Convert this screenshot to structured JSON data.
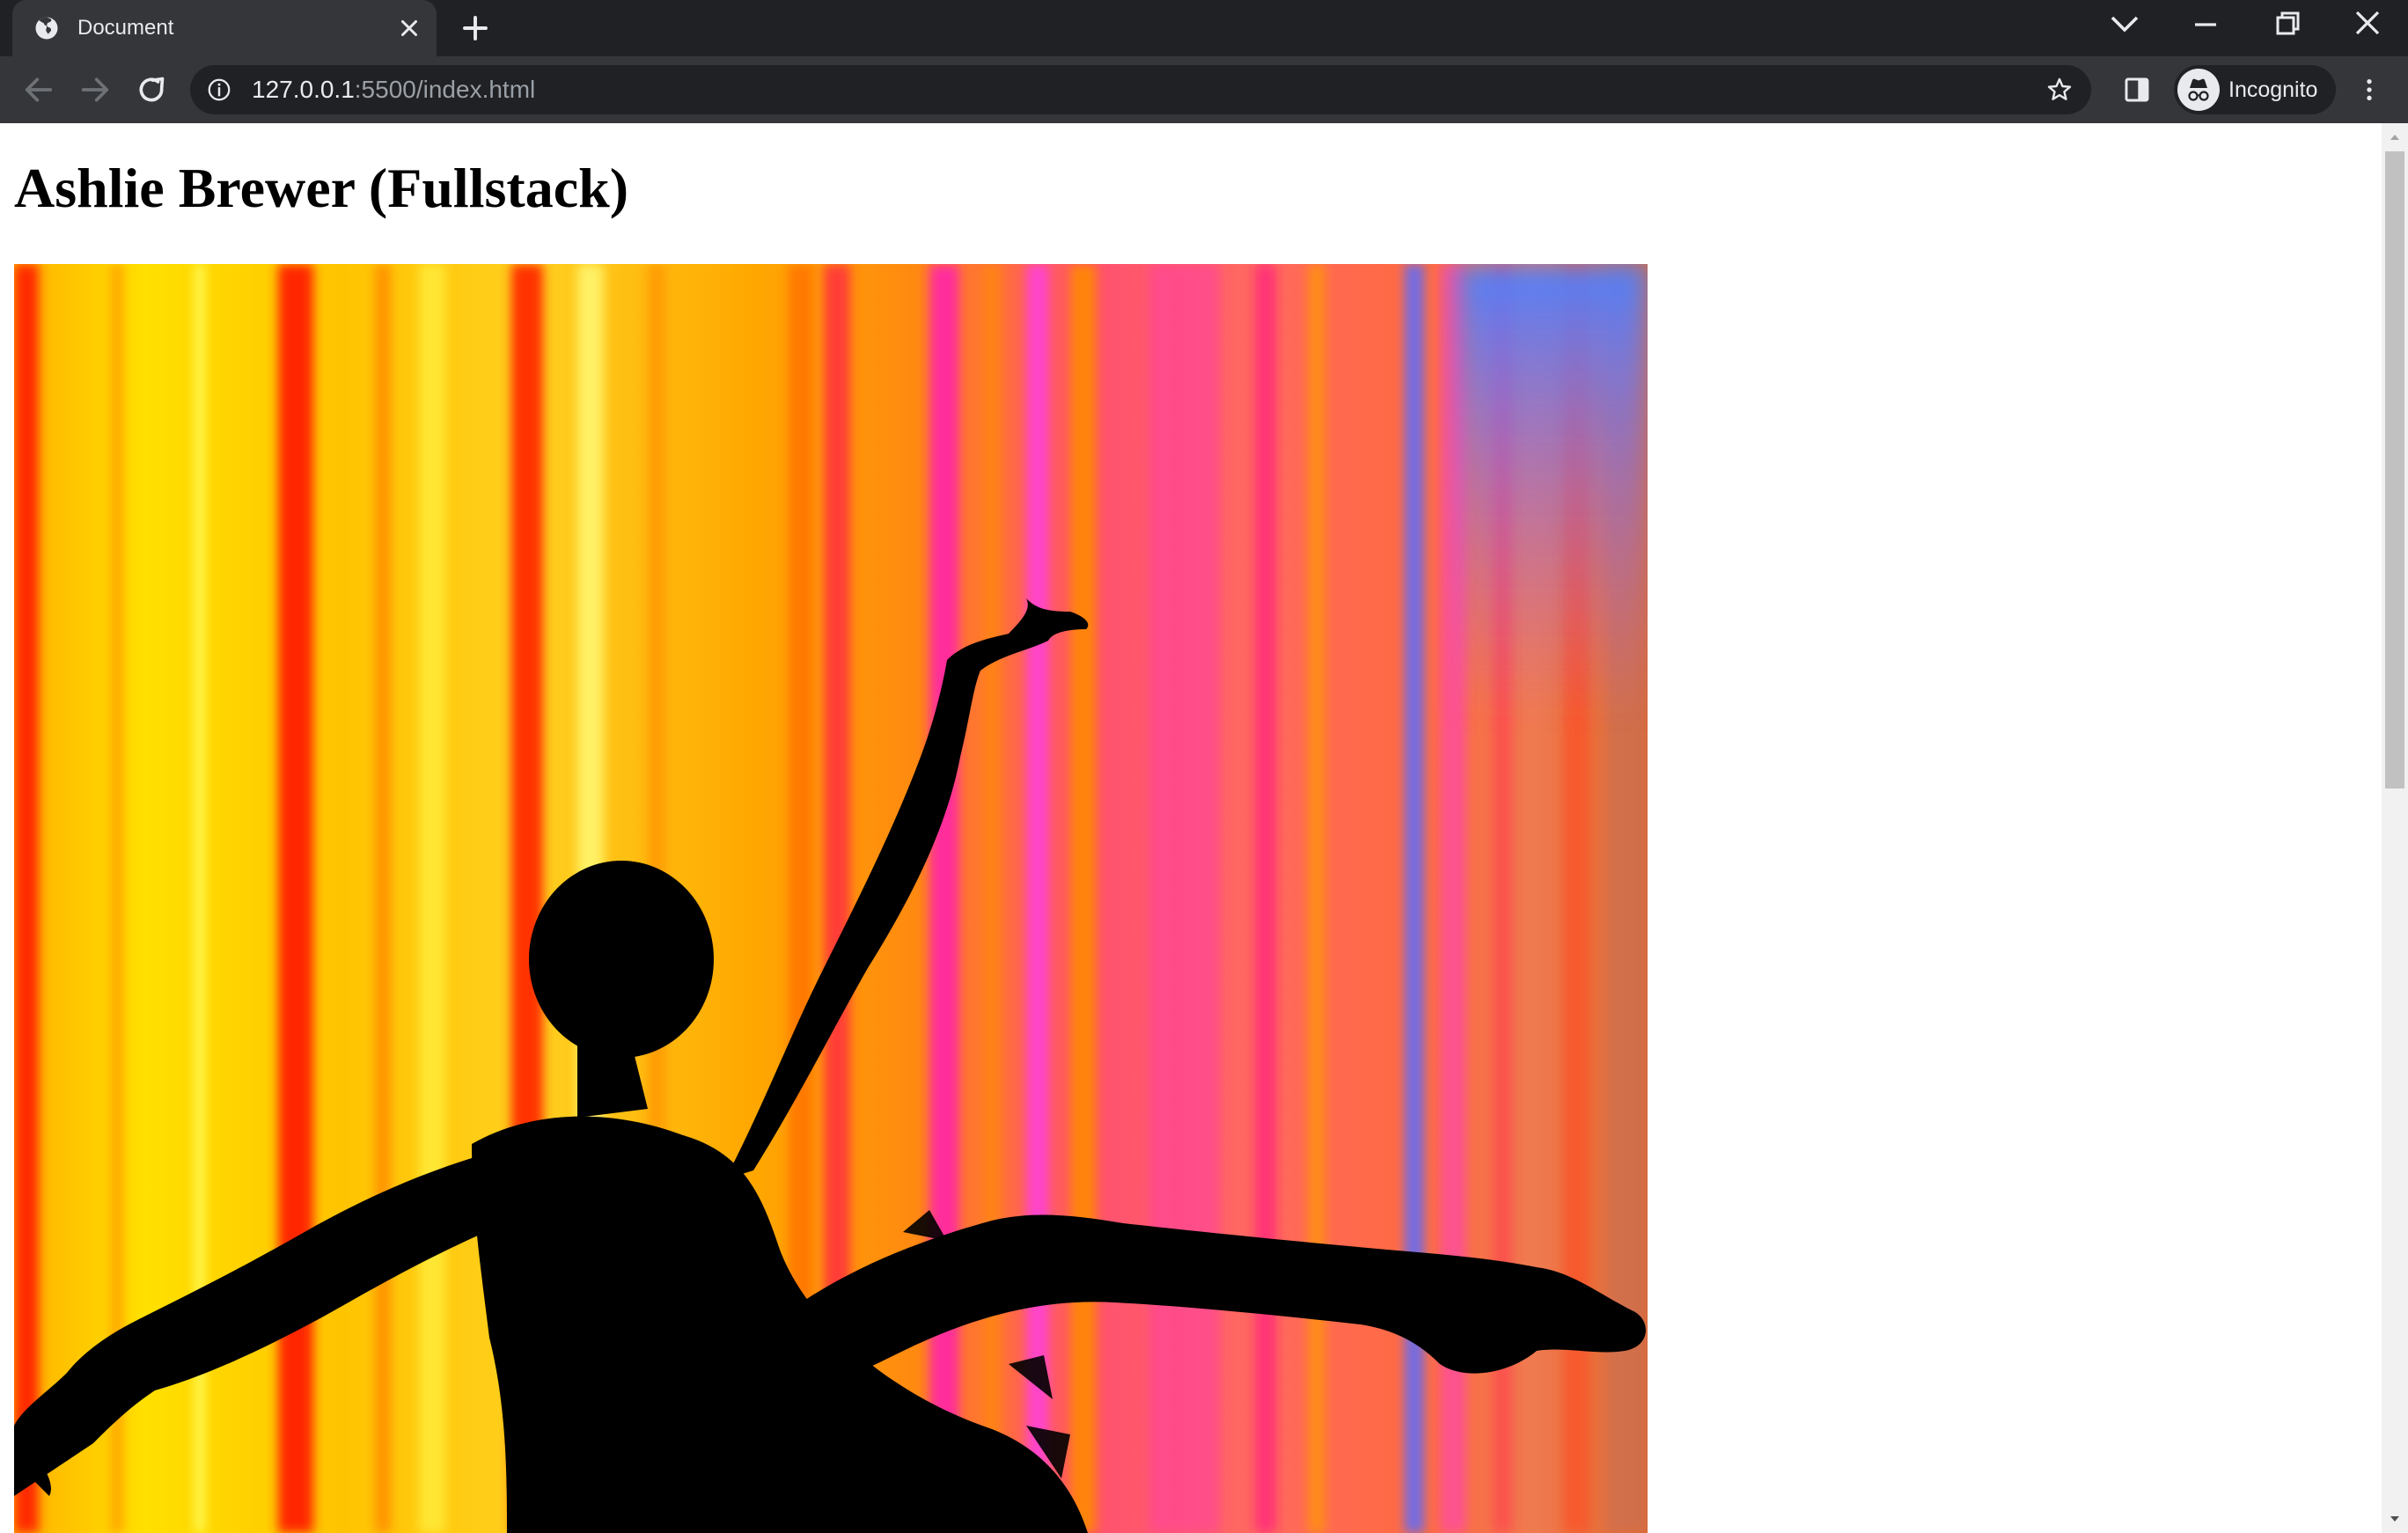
{
  "browser": {
    "tab": {
      "title": "Document"
    },
    "address_bar": {
      "host": "127.0.0.1",
      "port_and_path": ":5500/index.html"
    },
    "profile": {
      "label": "Incognito"
    }
  },
  "page": {
    "heading": "Ashlie Brewer (Fullstack)"
  },
  "icons": [
    "globe-icon",
    "close-icon",
    "plus-icon",
    "chevron-down-icon",
    "minimize-icon",
    "restore-icon",
    "window-close-icon",
    "back-icon",
    "forward-icon",
    "reload-icon",
    "info-icon",
    "star-icon",
    "side-panel-icon",
    "incognito-icon",
    "more-vert-icon"
  ],
  "colors": {
    "chrome_dark": "#202124",
    "chrome_toolbar": "#35363a",
    "chrome_text": "#e8eaed",
    "chrome_text_dim": "#9aa0a6"
  }
}
